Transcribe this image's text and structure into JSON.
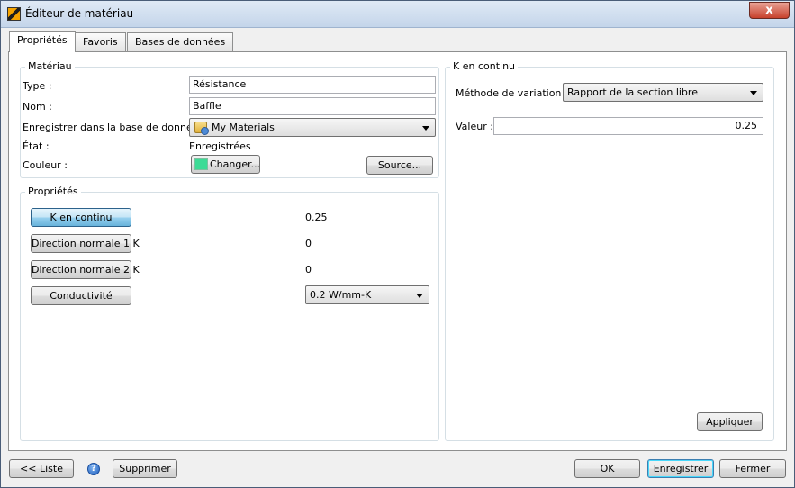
{
  "window": {
    "title": "Éditeur de matériau",
    "close_glyph": "x",
    "close_icon": "close-icon",
    "app_icon": "material-editor-icon"
  },
  "tabs": [
    {
      "label": "Propriétés",
      "active": true
    },
    {
      "label": "Favoris",
      "active": false
    },
    {
      "label": "Bases de données",
      "active": false
    }
  ],
  "material": {
    "group_title": "Matériau",
    "type_label": "Type :",
    "type_value": "Résistance",
    "name_label": "Nom :",
    "name_value": "Baffle",
    "save_db_label": "Enregistrer dans la base de données :",
    "save_db_value": "My Materials",
    "state_label": "État :",
    "state_value": "Enregistrées",
    "color_label": "Couleur :",
    "color_value": "#3ddb96",
    "change_button": "Changer...",
    "source_button": "Source..."
  },
  "properties": {
    "group_title": "Propriétés",
    "rows": [
      {
        "label": "K en continu",
        "value": "0.25"
      },
      {
        "label": "Direction normale 1 K",
        "value": "0"
      },
      {
        "label": "Direction normale 2 K",
        "value": "0"
      },
      {
        "label": "Conductivité",
        "value": "0.2 W/mm-K"
      }
    ]
  },
  "k_panel": {
    "group_title": "K en continu",
    "variation_label": "Méthode de variation :",
    "variation_value": "Rapport de la section libre",
    "value_label": "Valeur :",
    "value": "0.25",
    "apply_button": "Appliquer"
  },
  "footer": {
    "list_button": "<< Liste",
    "help_glyph": "?",
    "delete_button": "Supprimer",
    "ok_button": "OK",
    "save_button": "Enregistrer",
    "close_button": "Fermer"
  }
}
